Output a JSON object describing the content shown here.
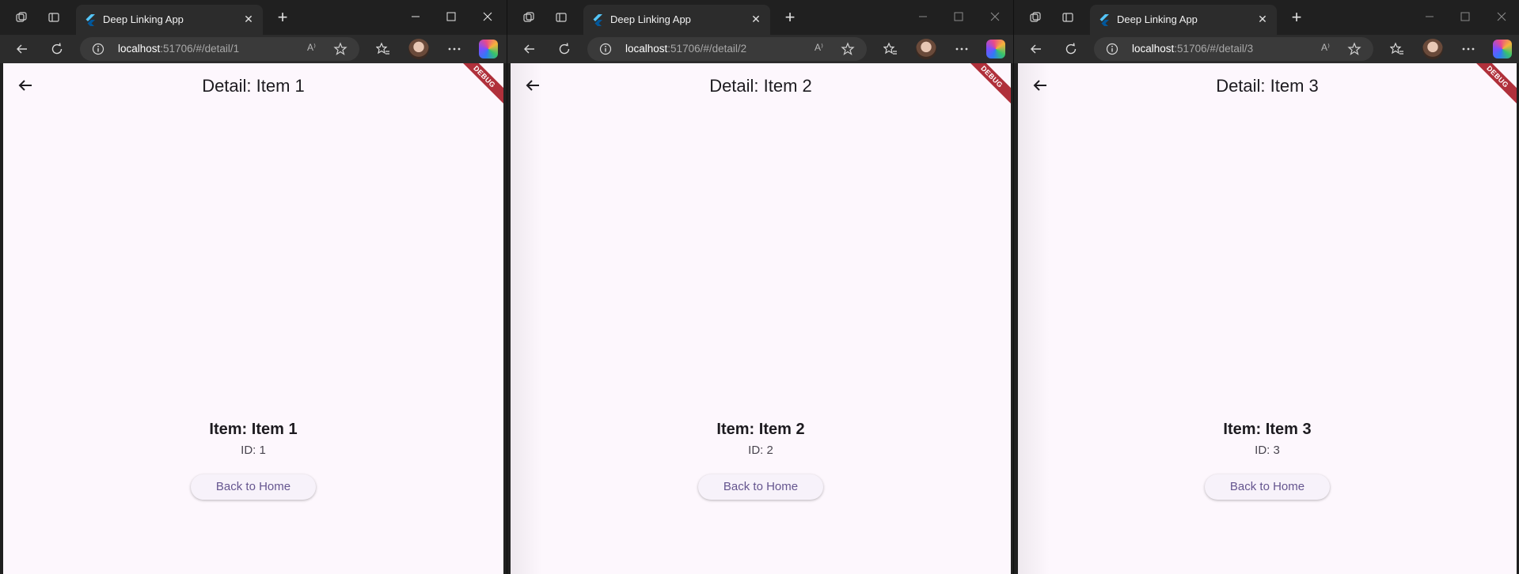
{
  "windows": [
    {
      "tab_title": "Deep Linking App",
      "url_host": "localhost",
      "url_path": ":51706/#/detail/1",
      "read_aloud": "A⁾",
      "page_title": "Detail: Item 1",
      "debug_label": "DEBUG",
      "item_title": "Item: Item 1",
      "item_id": "ID: 1",
      "home_button": "Back to Home"
    },
    {
      "tab_title": "Deep Linking App",
      "url_host": "localhost",
      "url_path": ":51706/#/detail/2",
      "read_aloud": "A⁾",
      "page_title": "Detail: Item 2",
      "debug_label": "DEBUG",
      "item_title": "Item: Item 2",
      "item_id": "ID: 2",
      "home_button": "Back to Home"
    },
    {
      "tab_title": "Deep Linking App",
      "url_host": "localhost",
      "url_path": ":51706/#/detail/3",
      "read_aloud": "A⁾",
      "page_title": "Detail: Item 3",
      "debug_label": "DEBUG",
      "item_title": "Item: Item 3",
      "item_id": "ID: 3",
      "home_button": "Back to Home"
    }
  ],
  "icons": {
    "workspaces": "workspaces-icon",
    "tab_actions": "tab-actions-icon",
    "favicon": "flutter-favicon-icon",
    "close_tab": "close-icon",
    "new_tab": "plus-icon",
    "minimize": "minimize-icon",
    "maximize": "maximize-icon",
    "close_window": "close-window-icon",
    "back": "back-arrow-icon",
    "refresh": "refresh-icon",
    "info": "info-icon",
    "favorite": "star-icon",
    "favorites_bar": "favorites-icon",
    "more": "more-icon",
    "copilot": "copilot-icon",
    "app_back": "arrow-left-icon"
  },
  "colors": {
    "browser_frame": "#202020",
    "toolbar": "#2c2c2c",
    "omnibox": "#3a3a3a",
    "page_bg": "#fdf7fd",
    "button_text": "#65558f",
    "debug_banner": "#b0303b"
  }
}
